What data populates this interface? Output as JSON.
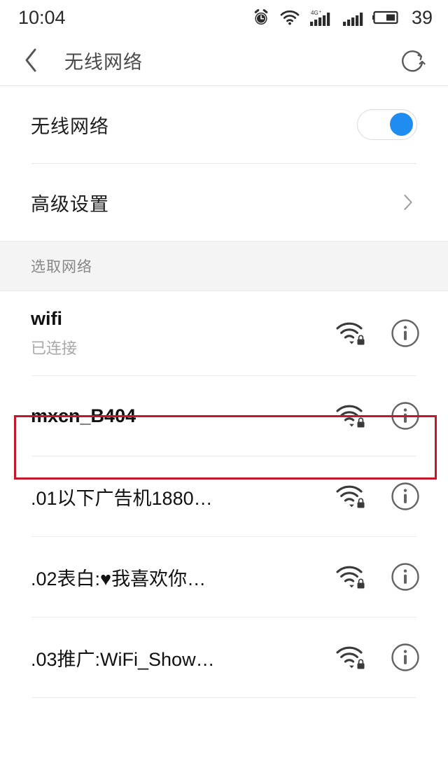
{
  "status_bar": {
    "time": "10:04",
    "battery_percent": "39",
    "network_label": "4G+",
    "icons": [
      "alarm-clock-icon",
      "wifi-icon",
      "signal-bars-icon",
      "signal-bars-icon",
      "battery-icon"
    ]
  },
  "header": {
    "back_icon": "chevron-left-icon",
    "title": "无线网络",
    "refresh_icon": "refresh-icon"
  },
  "settings": {
    "wifi_toggle_label": "无线网络",
    "wifi_toggle_state": "on",
    "advanced_label": "高级设置",
    "advanced_chevron": "chevron-right-icon"
  },
  "section": {
    "choose_network_label": "选取网络"
  },
  "networks": [
    {
      "ssid": "wifi",
      "status": "已连接",
      "secured": true,
      "signal": 3,
      "highlighted": false
    },
    {
      "ssid": "mxcn_B404",
      "status": "",
      "secured": true,
      "signal": 3,
      "highlighted": true
    },
    {
      "ssid": ".01以下广告机1880…",
      "status": "",
      "secured": true,
      "signal": 3,
      "highlighted": false
    },
    {
      "ssid": ".02表白:♥我喜欢你…",
      "status": "",
      "secured": true,
      "signal": 3,
      "highlighted": false
    },
    {
      "ssid": ".03推广:WiFi_Show…",
      "status": "",
      "secured": true,
      "signal": 3,
      "highlighted": false
    }
  ],
  "colors": {
    "accent_blue": "#1f8cf0",
    "highlight_red": "#c3172b",
    "section_bg": "#f4f4f4",
    "text_primary": "#111111",
    "text_secondary": "#a8a8a8"
  }
}
